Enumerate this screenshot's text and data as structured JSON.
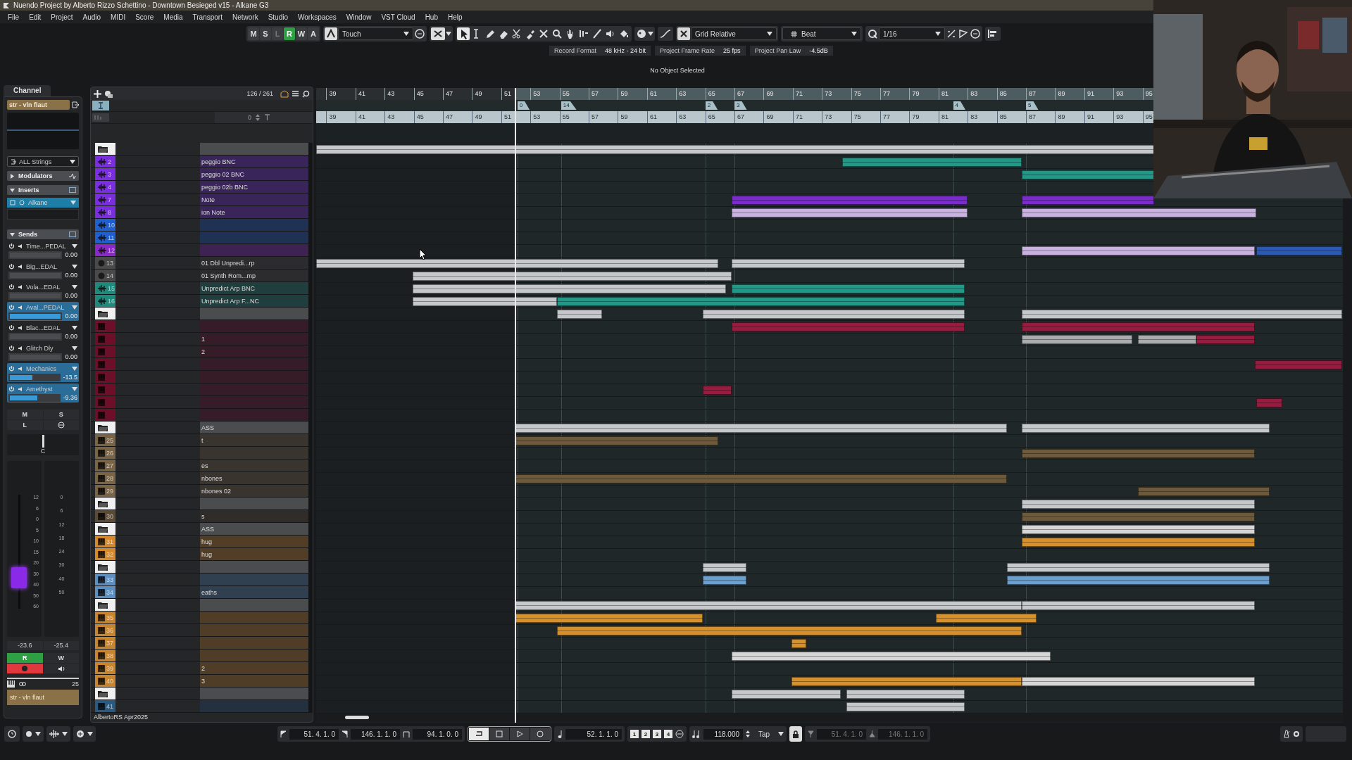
{
  "window": {
    "title": "Nuendo Project by Alberto Rizzo Schettino - Downtown Besieged v15 - Alkane G3"
  },
  "menu": [
    "File",
    "Edit",
    "Project",
    "Audio",
    "MIDI",
    "Score",
    "Media",
    "Transport",
    "Network",
    "Studio",
    "Workspaces",
    "Window",
    "VST Cloud",
    "Hub",
    "Help"
  ],
  "toolbar": {
    "buttons": [
      {
        "label": "M",
        "selected": false
      },
      {
        "label": "S",
        "selected": false
      },
      {
        "label": "L",
        "selected": false
      },
      {
        "label": "R",
        "selected": true
      },
      {
        "label": "W",
        "selected": false
      },
      {
        "label": "A",
        "selected": false
      }
    ],
    "automation_mode": "Touch",
    "snap_type": "Grid Relative",
    "grid": "Beat",
    "quantize": "1/16"
  },
  "info": [
    {
      "label": "Record Format",
      "value": "48 kHz - 24 bit"
    },
    {
      "label": "Project Frame Rate",
      "value": "25 fps"
    },
    {
      "label": "Project Pan Law",
      "value": "-4.5dB"
    }
  ],
  "status": "No Object Selected",
  "channel": {
    "tab": "Channel",
    "name": "str - vln flaut",
    "routing": "ALL Strings",
    "modulators": {
      "label": "Modulators",
      "expanded": false
    },
    "inserts": {
      "label": "Inserts",
      "expanded": true,
      "slots": [
        {
          "name": "Alkane",
          "on": true
        }
      ]
    },
    "sends": {
      "label": "Sends",
      "expanded": true,
      "slots": [
        {
          "name": "Time...PEDAL",
          "value": "0.00",
          "on": false,
          "level": 1
        },
        {
          "name": "Big...EDAL",
          "value": "0.00",
          "on": false,
          "level": 1
        },
        {
          "name": "Vola...EDAL",
          "value": "0.00",
          "on": false,
          "level": 1
        },
        {
          "name": "Aval...PEDAL",
          "value": "0.00",
          "on": true,
          "level": 1
        },
        {
          "name": "Blac...EDAL",
          "value": "0.00",
          "on": false,
          "level": 1
        },
        {
          "name": "Glitch Dly",
          "value": "0.00",
          "on": false,
          "level": 1
        },
        {
          "name": "Mechanics",
          "value": "-13.5",
          "on": true,
          "level": 0.45
        },
        {
          "name": "Amethyst",
          "value": "-9.36",
          "on": true,
          "level": 0.55
        }
      ]
    },
    "buttons": [
      {
        "label": "M",
        "on": false
      },
      {
        "label": "S",
        "on": false
      },
      {
        "label": "L",
        "on": false
      }
    ],
    "pan": "C",
    "fader": {
      "level": 0.27,
      "scale": [
        "12",
        "6",
        "0",
        "5",
        "10",
        "15",
        "20",
        "30",
        "40",
        "50",
        "60"
      ]
    },
    "meter": {
      "scale": [
        "0",
        "6",
        "12",
        "18",
        "24",
        "30",
        "40",
        "50"
      ]
    },
    "readouts": [
      "-23.6",
      "-25.4"
    ],
    "read": {
      "label": "R",
      "on": true
    },
    "write": {
      "label": "W",
      "on": false
    },
    "record_armed": true,
    "monitor": false,
    "number": "25",
    "footer_name": "str - vln flaut"
  },
  "tracklist": {
    "count": "126 / 261",
    "ruler_value": "0",
    "footer": "AlbertoRS Apr2025",
    "tracks": [
      {
        "kind": "folder"
      },
      {
        "kind": "audio",
        "number": "2",
        "name": "peggio BNC",
        "color": "#7a2ee0"
      },
      {
        "kind": "audio",
        "number": "3",
        "name": "peggio 02 BNC",
        "color": "#7a2ee0"
      },
      {
        "kind": "audio",
        "number": "4",
        "name": "peggio 02b BNC",
        "color": "#7a2ee0"
      },
      {
        "kind": "audio",
        "number": "7",
        "name": "Note",
        "color": "#7a2ee0"
      },
      {
        "kind": "audio",
        "number": "8",
        "name": "ion Note",
        "color": "#7a2ee0"
      },
      {
        "kind": "audio",
        "number": "10",
        "color": "#1f5fd0"
      },
      {
        "kind": "audio",
        "number": "11",
        "color": "#1f5fd0"
      },
      {
        "kind": "audio",
        "number": "12",
        "color": "#8a28c8"
      },
      {
        "kind": "disabled",
        "number": "13",
        "name": "01 Dbl Unpredi...rp",
        "color": "#4a4a4a"
      },
      {
        "kind": "disabled",
        "number": "14",
        "name": "01 Synth Rom...mp",
        "color": "#4a4a4a"
      },
      {
        "kind": "audio",
        "number": "15",
        "name": "Unpredict Arp BNC",
        "color": "#1d8a7c"
      },
      {
        "kind": "audio",
        "number": "16",
        "name": "Unpredict Arp F...NC",
        "color": "#1d8a7c"
      },
      {
        "kind": "folder"
      },
      {
        "kind": "instrument",
        "color": "#6e0f2a"
      },
      {
        "kind": "instrument",
        "name": "1",
        "color": "#6e0f2a"
      },
      {
        "kind": "instrument",
        "name": "2",
        "color": "#6e0f2a"
      },
      {
        "kind": "instrument",
        "color": "#6e0f2a"
      },
      {
        "kind": "instrument",
        "color": "#6e0f2a"
      },
      {
        "kind": "instrument",
        "color": "#6e0f2a"
      },
      {
        "kind": "instrument",
        "color": "#6e0f2a"
      },
      {
        "kind": "instrument",
        "color": "#6e0f2a"
      },
      {
        "kind": "folder",
        "name": "ASS"
      },
      {
        "kind": "instrument",
        "number": "25",
        "name": "t",
        "color": "#7a6446"
      },
      {
        "kind": "instrument",
        "number": "26",
        "color": "#7a6446"
      },
      {
        "kind": "instrument",
        "number": "27",
        "name": "es",
        "color": "#7a6446"
      },
      {
        "kind": "instrument",
        "number": "28",
        "name": "nbones",
        "color": "#7a6446"
      },
      {
        "kind": "instrument",
        "number": "29",
        "name": "nbones 02",
        "color": "#7a6446"
      },
      {
        "kind": "folder"
      },
      {
        "kind": "instrument",
        "number": "30",
        "name": "s",
        "color": "#5a4a36"
      },
      {
        "kind": "folder",
        "name": "ASS"
      },
      {
        "kind": "instrument",
        "number": "31",
        "name": "hug",
        "color": "#d4892c"
      },
      {
        "kind": "instrument",
        "number": "32",
        "name": "hug",
        "color": "#d4892c"
      },
      {
        "kind": "folder"
      },
      {
        "kind": "instrument",
        "number": "33",
        "color": "#5d8fc0"
      },
      {
        "kind": "instrument",
        "number": "34",
        "name": "eaths",
        "color": "#5d8fc0"
      },
      {
        "kind": "folder"
      },
      {
        "kind": "instrument",
        "number": "35",
        "color": "#c88530"
      },
      {
        "kind": "instrument",
        "number": "36",
        "color": "#c88530"
      },
      {
        "kind": "instrument",
        "number": "37",
        "color": "#c88530"
      },
      {
        "kind": "instrument",
        "number": "38",
        "color": "#c88530"
      },
      {
        "kind": "instrument",
        "number": "39",
        "name": "2",
        "color": "#c88530"
      },
      {
        "kind": "instrument",
        "number": "40",
        "name": "3",
        "color": "#c88530"
      },
      {
        "kind": "folder"
      },
      {
        "kind": "instrument",
        "number": "41",
        "color": "#2a5a80"
      }
    ]
  },
  "ruler": {
    "bars": [
      "39",
      "41",
      "43",
      "45",
      "47",
      "49",
      "51",
      "53",
      "55",
      "57",
      "59",
      "61",
      "63",
      "65",
      "67",
      "69",
      "71",
      "73",
      "75",
      "77",
      "79",
      "81",
      "83",
      "85",
      "87",
      "89",
      "91",
      "93",
      "95"
    ],
    "markers": [
      {
        "label": "0"
      },
      {
        "label": "14"
      },
      {
        "label": "2"
      },
      {
        "label": "3"
      },
      {
        "label": "4"
      },
      {
        "label": "5"
      }
    ],
    "time_bars": [
      "39",
      "41",
      "43",
      "45",
      "47",
      "49",
      "51",
      "53",
      "55",
      "57",
      "59",
      "61",
      "63",
      "65",
      "67",
      "69",
      "71",
      "73",
      "75",
      "77",
      "79",
      "81",
      "83",
      "85",
      "87",
      "89",
      "91",
      "93",
      "95"
    ]
  },
  "transport": {
    "left_locator": "51. 4. 1. 0",
    "right_locator": "146. 1. 1. 0",
    "length": "94. 1. 0. 0",
    "cycle": true,
    "position": "52. 1. 1. 0",
    "presets": [
      "1",
      "2",
      "3",
      "4"
    ],
    "tempo": "118.000",
    "tap": "Tap",
    "punch_in": "51. 4. 1. 0",
    "punch_out": "146. 1. 1. 0"
  }
}
